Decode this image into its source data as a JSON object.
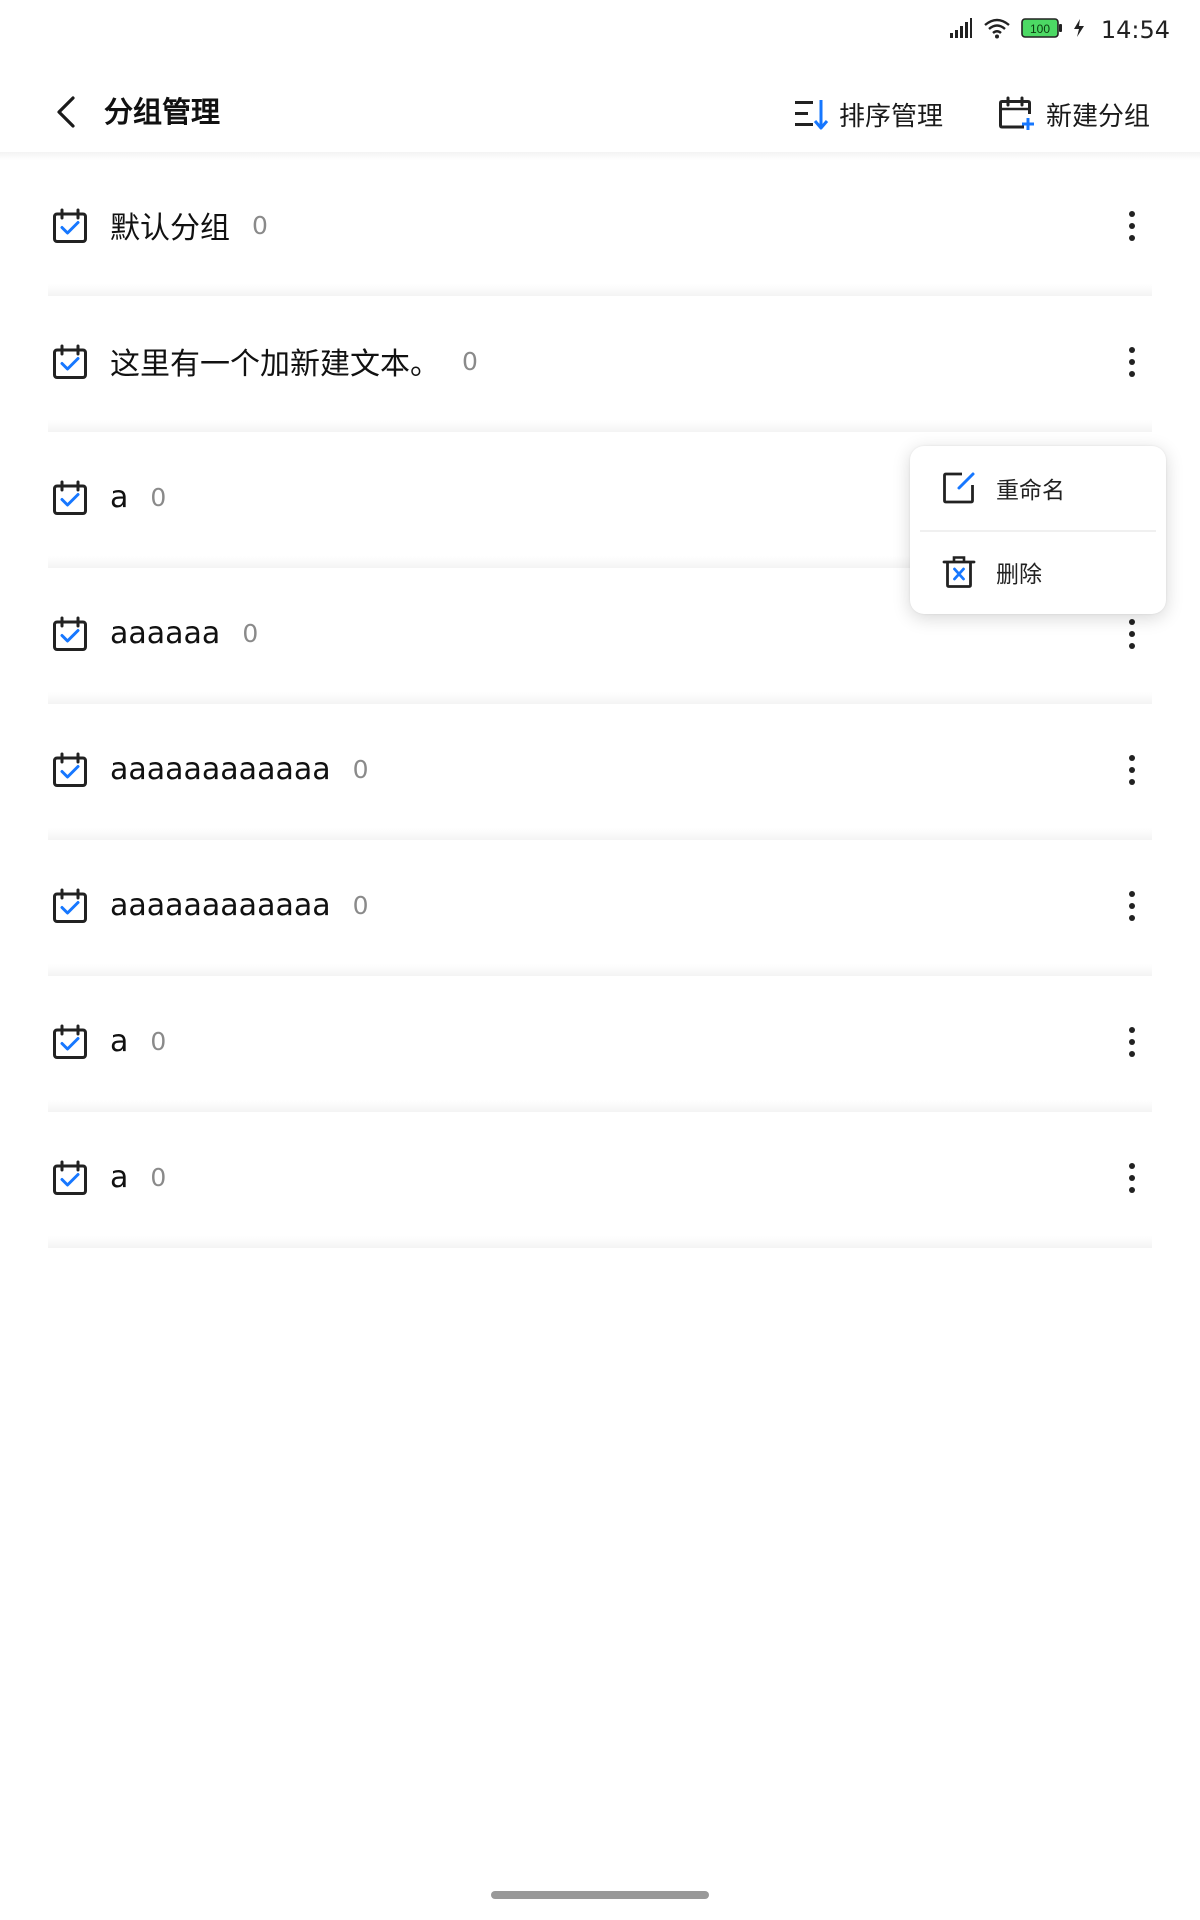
{
  "status_bar": {
    "time": "14:54",
    "battery": "100",
    "icons": [
      "signal-icon",
      "wifi-icon",
      "battery-icon",
      "charging-icon"
    ]
  },
  "header": {
    "title": "分组管理",
    "sort_label": "排序管理",
    "new_label": "新建分组"
  },
  "groups": [
    {
      "name": "默认分组",
      "count": "0"
    },
    {
      "name": "这里有一个加新建文本。",
      "count": "0"
    },
    {
      "name": "a",
      "count": "0"
    },
    {
      "name": "aaaaaa",
      "count": "0"
    },
    {
      "name": "aaaaaaaaaaaa",
      "count": "0"
    },
    {
      "name": "aaaaaaaaaaaa",
      "count": "0"
    },
    {
      "name": "a",
      "count": "0"
    },
    {
      "name": "a",
      "count": "0"
    }
  ],
  "popup_menu": {
    "rename_label": "重命名",
    "delete_label": "删除"
  },
  "colors": {
    "accent": "#1677ff",
    "icon_dark": "#222222",
    "count_gray": "#8a8a8a",
    "battery_green": "#4cd964"
  }
}
